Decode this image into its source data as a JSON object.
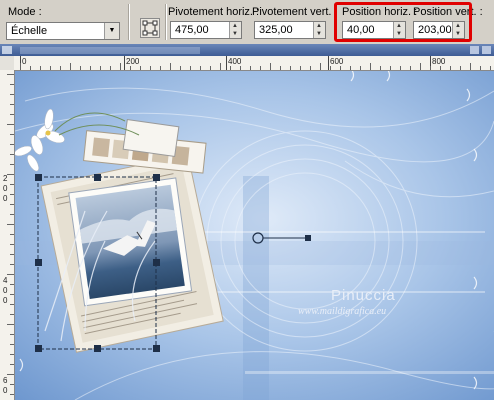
{
  "toolbar": {
    "mode_label": "Mode :",
    "mode_value": "Échelle",
    "pivot_h_label": "Pivotement horiz. :",
    "pivot_h_value": "475,00",
    "pivot_v_label": "Pivotement vert. :",
    "pivot_v_value": "325,00",
    "pos_h_label": "Position horiz. :",
    "pos_h_value": "40,00",
    "pos_v_label": "Position vert. :",
    "pos_v_value": "203,00"
  },
  "ruler": {
    "h_ticks": [
      "0",
      "200",
      "400",
      "600",
      "800"
    ],
    "v_ticks": [
      "2",
      "0",
      "0",
      "4",
      "0",
      "0",
      "6",
      "0"
    ]
  },
  "canvas": {
    "watermark_name": "Pinuccia",
    "watermark_url": "www.maildigrafica.eu",
    "colors": {
      "bg_light": "#c9dcf2",
      "bg_mid": "#8fb1dc",
      "bg_dark": "#5d86c2",
      "selection": "#1e2f48",
      "highlight": "#e00000"
    }
  },
  "icons": [
    "dropdown-arrow-icon",
    "transform-tool-icon",
    "spin-up-icon",
    "spin-down-icon",
    "pivot-handle-icon"
  ]
}
